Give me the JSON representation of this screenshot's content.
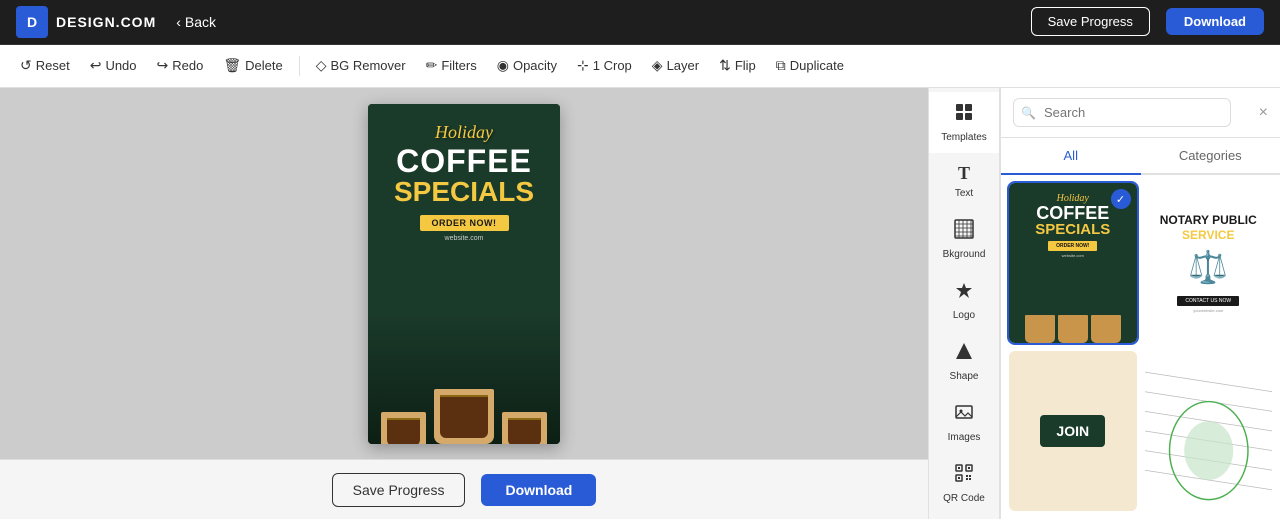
{
  "brand": {
    "name": "DESIGN.COM",
    "logo_letter": "D"
  },
  "header": {
    "back_label": "Back",
    "save_progress_label": "Save Progress",
    "download_label": "Download"
  },
  "toolbar": {
    "items": [
      {
        "id": "reset",
        "label": "Reset",
        "icon": "↺"
      },
      {
        "id": "undo",
        "label": "Undo",
        "icon": "↩"
      },
      {
        "id": "redo",
        "label": "Redo",
        "icon": "↪"
      },
      {
        "id": "delete",
        "label": "Delete",
        "icon": "🗑"
      },
      {
        "id": "bg-remover",
        "label": "BG Remover",
        "icon": "◇"
      },
      {
        "id": "filters",
        "label": "Filters",
        "icon": "✏"
      },
      {
        "id": "opacity",
        "label": "Opacity",
        "icon": "◉"
      },
      {
        "id": "crop",
        "label": "1 Crop",
        "icon": "⊞"
      },
      {
        "id": "layer",
        "label": "Layer",
        "icon": "◈"
      },
      {
        "id": "flip",
        "label": "Flip",
        "icon": "⇅"
      },
      {
        "id": "duplicate",
        "label": "Duplicate",
        "icon": "⧉"
      }
    ]
  },
  "sidebar": {
    "items": [
      {
        "id": "templates",
        "label": "Templates",
        "icon": "⊞",
        "active": true
      },
      {
        "id": "text",
        "label": "Text",
        "icon": "T"
      },
      {
        "id": "bkground",
        "label": "Bkground",
        "icon": "▦"
      },
      {
        "id": "logo",
        "label": "Logo",
        "icon": "✦"
      },
      {
        "id": "shape",
        "label": "Shape",
        "icon": "▲"
      },
      {
        "id": "images",
        "label": "Images",
        "icon": "🖼"
      },
      {
        "id": "qr-code",
        "label": "QR Code",
        "icon": "⊞"
      }
    ]
  },
  "right_panel": {
    "search_placeholder": "Search",
    "tabs": [
      {
        "id": "all",
        "label": "All",
        "active": true
      },
      {
        "id": "categories",
        "label": "Categories",
        "active": false
      }
    ]
  },
  "canvas": {
    "card": {
      "holiday": "Holiday",
      "coffee": "COFFEE",
      "specials": "SPECIALS",
      "order": "ORDER NOW!",
      "website": "website.com"
    }
  },
  "bottom": {
    "save_label": "Save Progress",
    "download_label": "Download"
  },
  "templates": [
    {
      "id": "coffee",
      "type": "coffee",
      "selected": true
    },
    {
      "id": "notary",
      "type": "notary",
      "selected": false
    },
    {
      "id": "join",
      "type": "join",
      "selected": false
    },
    {
      "id": "abstract",
      "type": "abstract",
      "selected": false
    }
  ],
  "colors": {
    "accent": "#2a5bd7",
    "dark_green": "#1a3a2a",
    "gold": "#f5c842"
  }
}
